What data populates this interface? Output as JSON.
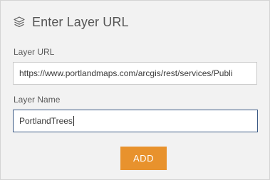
{
  "header": {
    "icon": "layers-icon",
    "title": "Enter Layer URL"
  },
  "fields": {
    "url": {
      "label": "Layer URL",
      "value": "https://www.portlandmaps.com/arcgis/rest/services/Publi"
    },
    "name": {
      "label": "Layer Name",
      "value": "PortlandTrees"
    }
  },
  "actions": {
    "add_label": "ADD"
  },
  "colors": {
    "panel_bg": "#f2f2f2",
    "accent": "#e8922d",
    "focus_border": "#3c5a85"
  }
}
